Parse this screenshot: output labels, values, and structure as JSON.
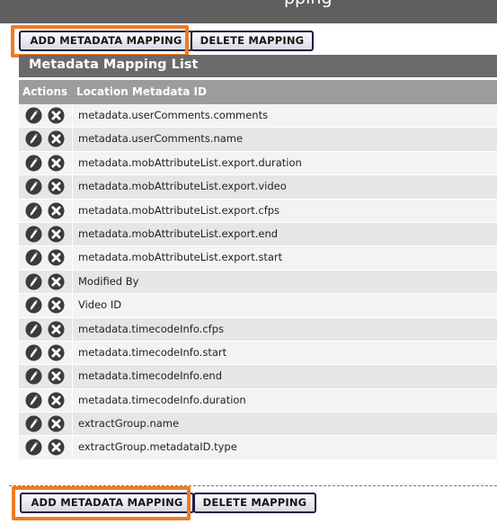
{
  "top_bar": {
    "partial_title": "pping"
  },
  "toolbar": {
    "add_label": "ADD METADATA MAPPING",
    "delete_label": "DELETE MAPPING"
  },
  "list": {
    "title": "Metadata Mapping List",
    "columns": {
      "actions": "Actions",
      "location_id": "Location Metadata ID"
    },
    "rows": [
      "metadata.userComments.comments",
      "metadata.userComments.name",
      "metadata.mobAttributeList.export.duration",
      "metadata.mobAttributeList.export.video",
      "metadata.mobAttributeList.export.cfps",
      "metadata.mobAttributeList.export.end",
      "metadata.mobAttributeList.export.start",
      "Modified By",
      "Video ID",
      "metadata.timecodeInfo.cfps",
      "metadata.timecodeInfo.start",
      "metadata.timecodeInfo.end",
      "metadata.timecodeInfo.duration",
      "extractGroup.name",
      "extractGroup.metadataID.type"
    ]
  },
  "colors": {
    "highlight": "#f07a21",
    "icon": "#3b3b3b",
    "header_bg": "#6a6a6a",
    "column_header_bg": "#9c9c9c"
  },
  "icons": {
    "edit": "pencil-icon",
    "delete": "x-circle-icon"
  }
}
